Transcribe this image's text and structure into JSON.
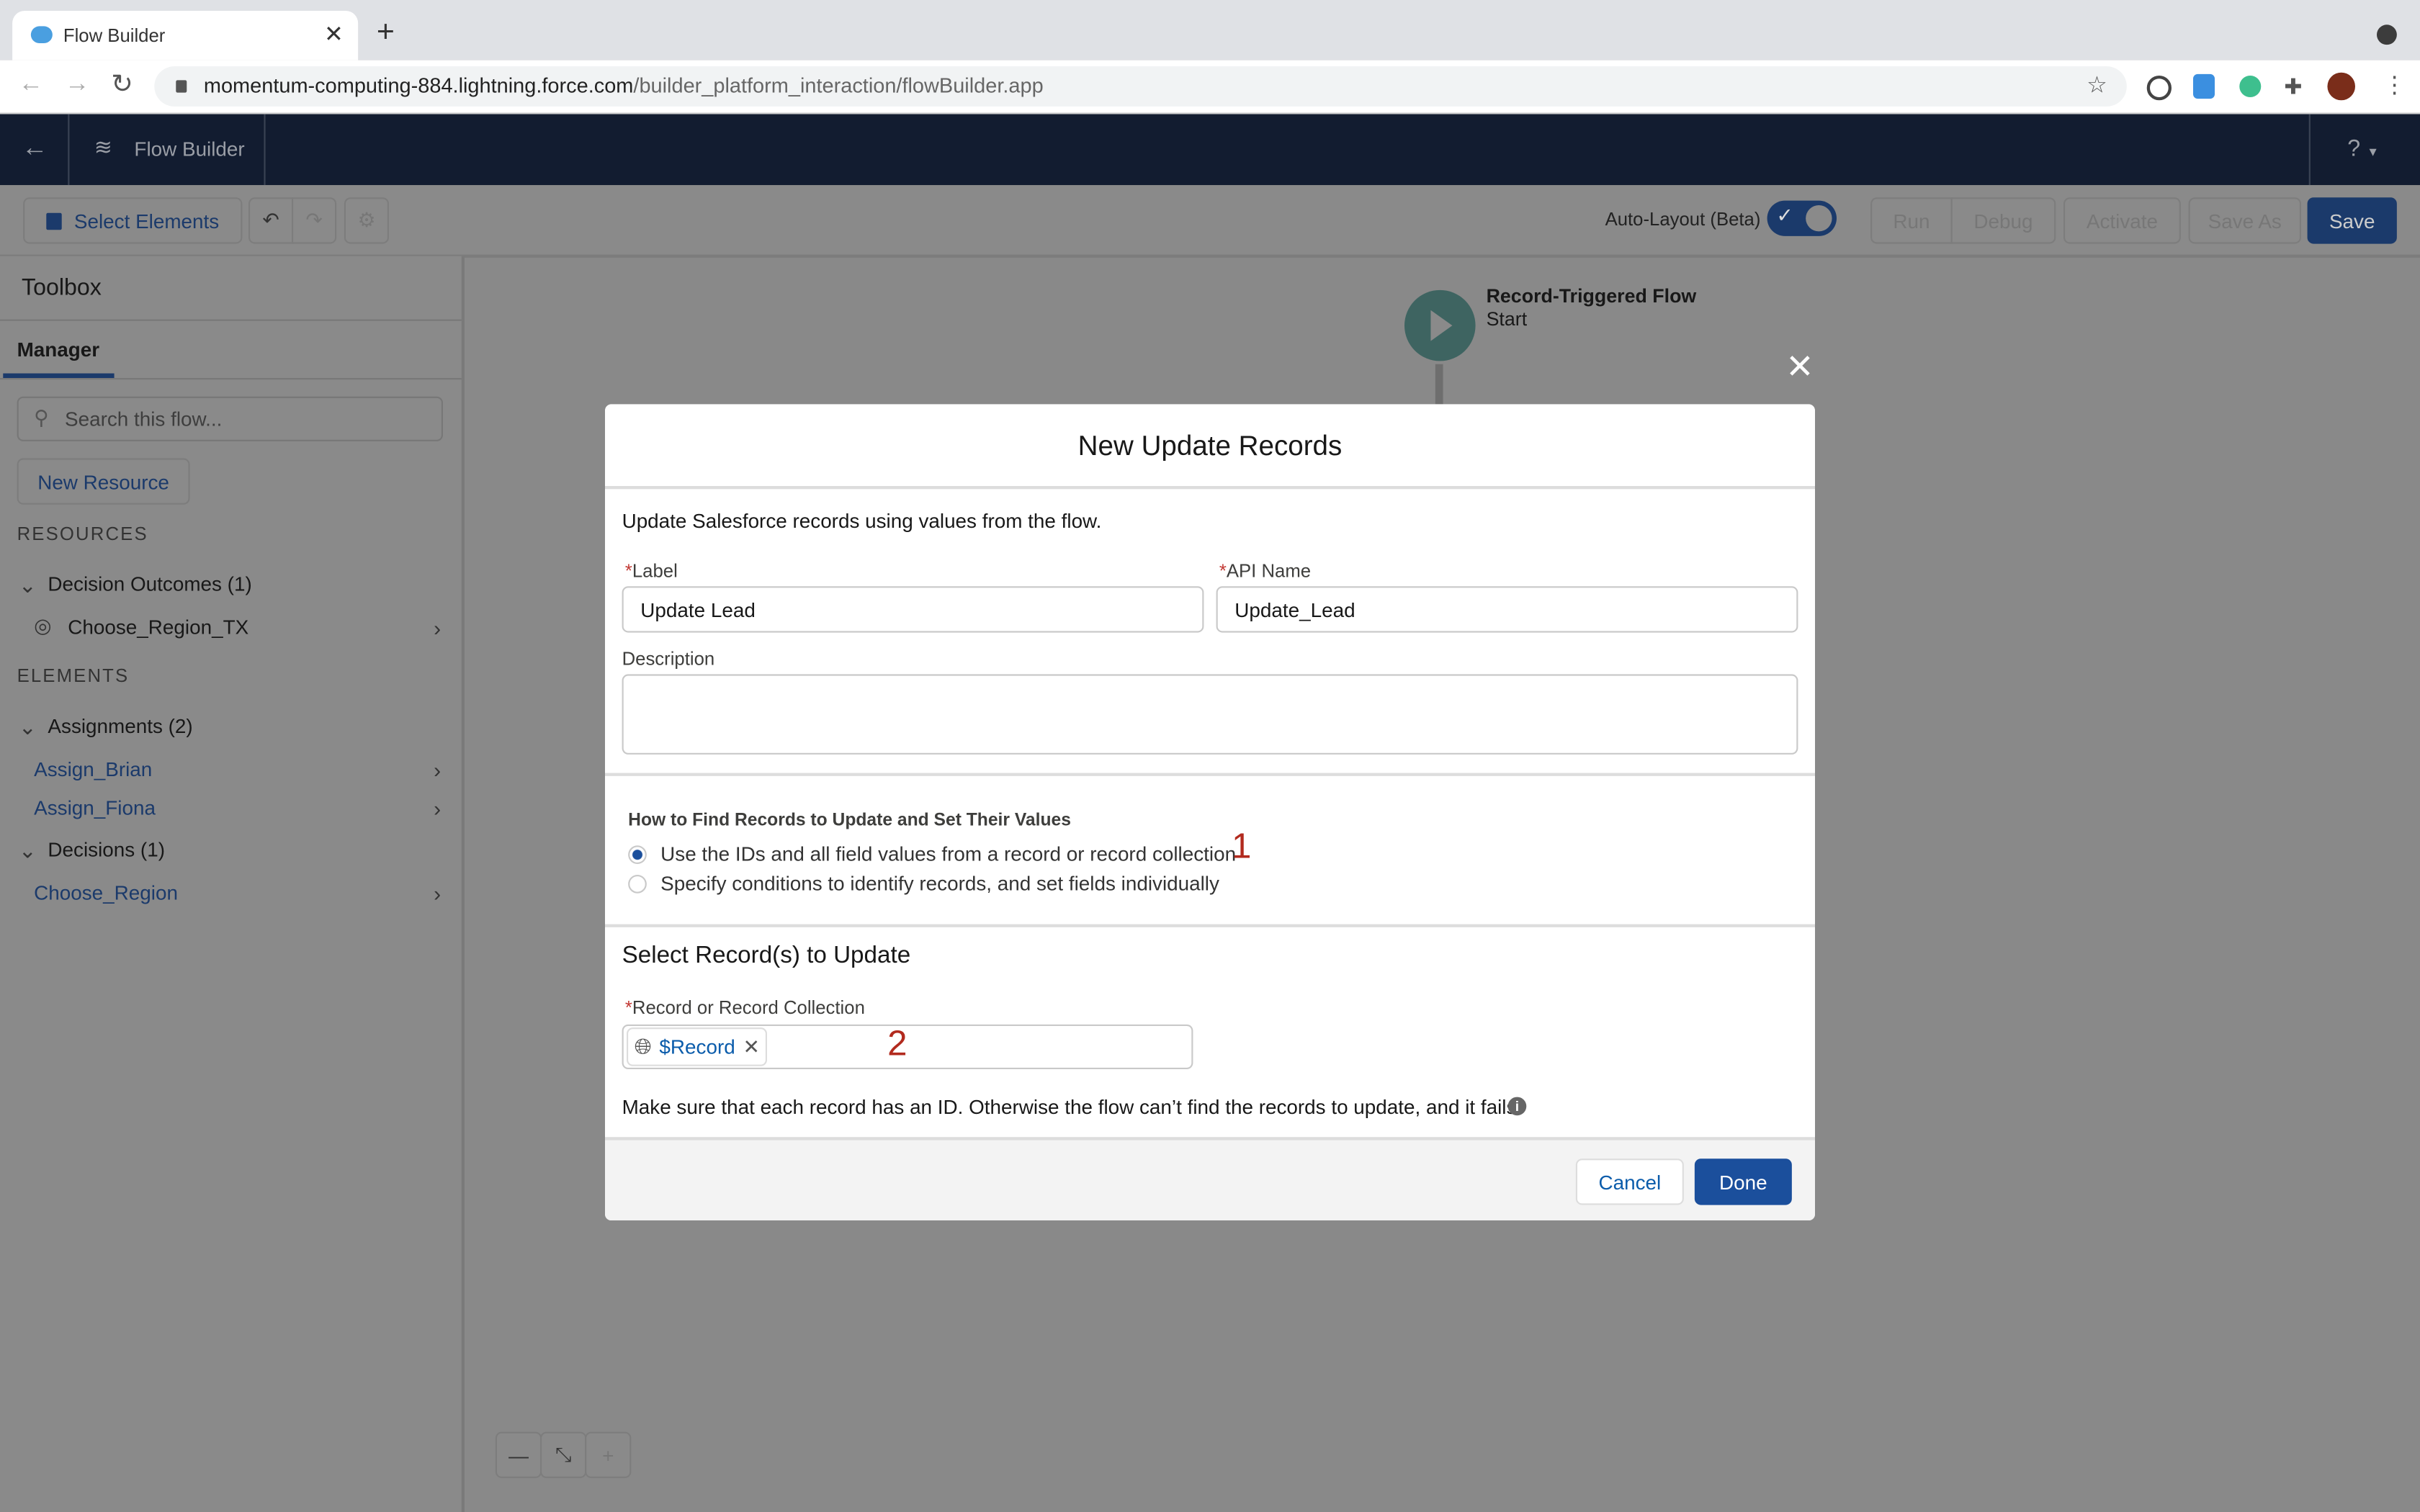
{
  "browser": {
    "tab_title": "Flow Builder",
    "url_host": "momentum-computing-884.lightning.force.com",
    "url_path": "/builder_platform_interaction/flowBuilder.app"
  },
  "nav": {
    "app_title": "Flow Builder",
    "help": "?"
  },
  "toolbar": {
    "select_elements": "Select Elements",
    "auto_layout": "Auto-Layout (Beta)",
    "auto_layout_on": true,
    "run": "Run",
    "debug": "Debug",
    "activate": "Activate",
    "save_as": "Save As",
    "save": "Save"
  },
  "sidebar": {
    "title": "Toolbox",
    "tab": "Manager",
    "search_placeholder": "Search this flow...",
    "new_resource": "New Resource",
    "resources_heading": "RESOURCES",
    "decision_outcomes": "Decision Outcomes (1)",
    "outcome_item": "Choose_Region_TX",
    "elements_heading": "ELEMENTS",
    "assignments": "Assignments (2)",
    "assign_items": [
      "Assign_Brian",
      "Assign_Fiona"
    ],
    "decisions": "Decisions (1)",
    "decision_items": [
      "Choose_Region"
    ]
  },
  "canvas": {
    "start_title": "Record-Triggered Flow",
    "start_sub": "Start"
  },
  "modal": {
    "title": "New Update Records",
    "intro": "Update Salesforce records using values from the flow.",
    "label_label": "Label",
    "label_value": "Update Lead",
    "api_label": "API Name",
    "api_value": "Update_Lead",
    "description_label": "Description",
    "description_value": "",
    "how_heading": "How to Find Records to Update and Set Their Values",
    "option1": "Use the IDs and all field values from a record or record collection",
    "option2": "Specify conditions to identify records, and set fields individually",
    "selected_option": 1,
    "annotation1": "1",
    "select_heading": "Select Record(s) to Update",
    "record_label": "Record or Record Collection",
    "record_pill": "$Record",
    "annotation2": "2",
    "note": "Make sure that each record has an ID. Otherwise the flow can’t find the records to update, and it fails.",
    "cancel": "Cancel",
    "done": "Done"
  },
  "colors": {
    "brand": "#1b3a6b",
    "nav": "#121c30",
    "start_node": "#3e6461",
    "annotation": "#b22a1e"
  }
}
